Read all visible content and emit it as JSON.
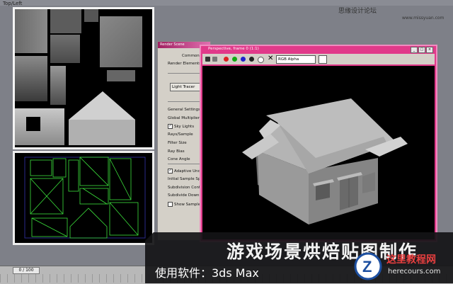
{
  "viewport_label": "Top/Left",
  "watermark": {
    "site": "思缘设计论坛",
    "url": "www.missyuan.com"
  },
  "render_setup": {
    "title": "Render Scene",
    "tabs": [
      "Common",
      "Render Elements"
    ],
    "advanced_lighting": "Light Tracer",
    "general_settings": "General Settings",
    "global_multiplier": "Global Multiplier",
    "sky_lights": "Sky Lights",
    "rays_sample": "Rays/Sample",
    "filter_size": "Filter Size",
    "ray_bias": "Ray Bias",
    "cone_angle": "Cone Angle",
    "adaptive": "Adaptive Under",
    "initial_sample": "Initial Sample Spa",
    "subdivision_contrast": "Subdivision Contr",
    "subdivide_down": "Subdivide Down",
    "show_samples": "Show Sample"
  },
  "render_frame": {
    "title": "Perspective, frame 0 (1:1)",
    "channel": "RGB Alpha"
  },
  "timeline": {
    "frame": "0 / 100"
  },
  "banner": {
    "title": "游戏场景烘焙贴图制作",
    "subtitle": "使用软件：3ds Max"
  },
  "logo": {
    "name": "这里教程网",
    "url": "herecours.com"
  }
}
